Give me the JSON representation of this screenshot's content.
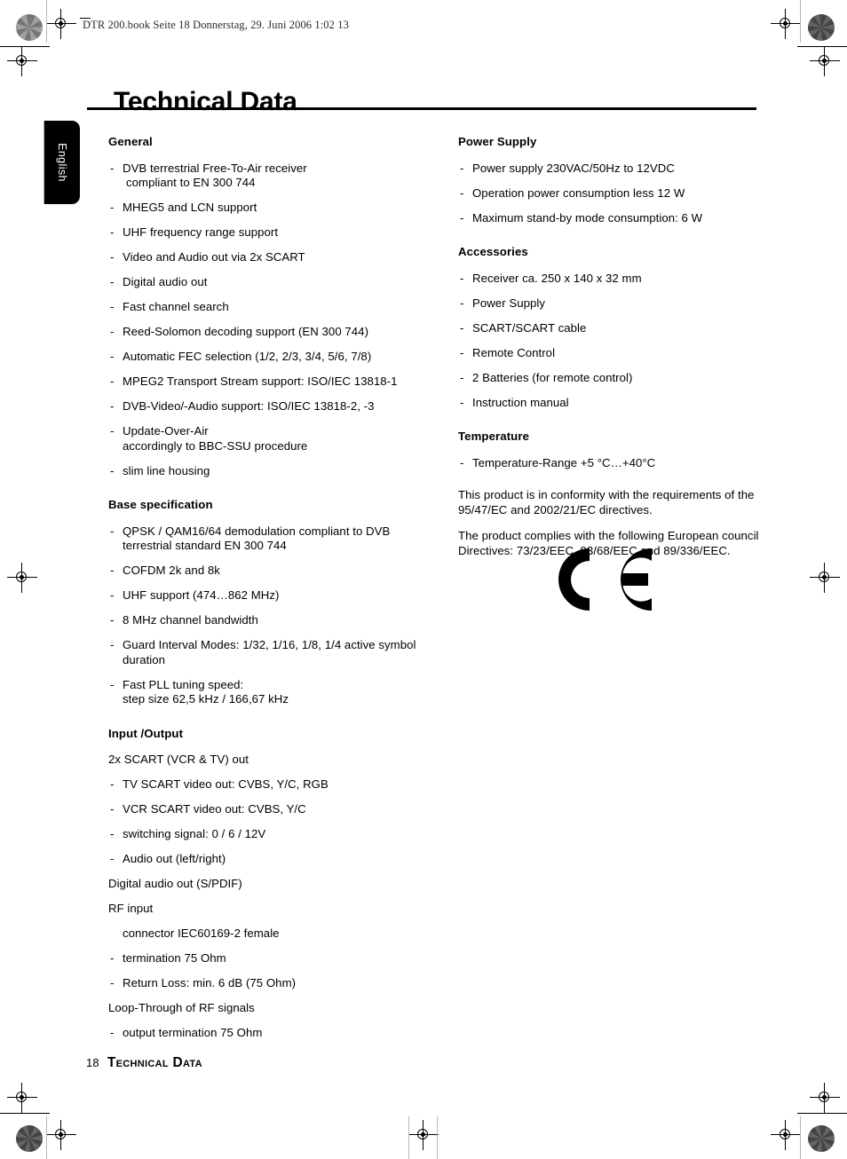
{
  "slug": {
    "text": "DTR 200.book  Seite 18  Donnerstag, 29. Juni 2006  1:02 13"
  },
  "header": {
    "title": "Technical Data"
  },
  "language_tab": {
    "label": "English"
  },
  "left_column": {
    "sections": [
      {
        "heading": "General",
        "items": [
          {
            "dash": "-",
            "text": "DVB terrestrial Free-To-Air receiver",
            "cont": "compliant to EN 300 744"
          },
          {
            "dash": "-",
            "text": "MHEG5 and LCN support"
          },
          {
            "dash": "-",
            "text": "UHF frequency range support"
          },
          {
            "dash": "-",
            "text": "Video and Audio out via 2x SCART"
          },
          {
            "dash": "-",
            "text": "Digital audio out"
          },
          {
            "dash": "-",
            "text": "Fast channel search"
          },
          {
            "dash": "-",
            "text": "Reed-Solomon decoding support (EN 300 744)"
          },
          {
            "dash": "-",
            "text": "Automatic FEC selection (1/2, 2/3, 3/4, 5/6, 7/8)"
          },
          {
            "dash": "-",
            "text": "MPEG2 Transport Stream support: ISO/IEC 13818-1"
          },
          {
            "dash": "-",
            "text": "DVB-Video/-Audio support: ISO/IEC 13818-2, -3"
          },
          {
            "dash": "-",
            "text": "Update-Over-Air",
            "cont": "accordingly to BBC-SSU procedure",
            "cont_flush": true
          },
          {
            "dash": "-",
            "text": "slim line housing"
          }
        ]
      },
      {
        "heading": "Base specification",
        "items": [
          {
            "dash": "-",
            "text": "QPSK / QAM16/64 demodulation compliant to DVB",
            "cont": "terrestrial standard EN 300 744",
            "cont_flush": true
          },
          {
            "dash": "-",
            "text": "COFDM 2k and 8k"
          },
          {
            "dash": "-",
            "text": "UHF support (474…862 MHz)"
          },
          {
            "dash": "-",
            "text": "8 MHz channel bandwidth"
          },
          {
            "dash": "-",
            "text": "Guard Interval Modes: 1/32, 1/16, 1/8, 1/4 active symbol",
            "cont": "duration",
            "cont_flush": true
          },
          {
            "dash": "-",
            "text": "Fast PLL tuning speed:",
            "cont": "step size 62,5 kHz / 166,67 kHz",
            "cont_flush": true
          }
        ]
      },
      {
        "heading": "Input /Output",
        "items": [
          {
            "dash": "",
            "text": "2x SCART (VCR & TV) out"
          },
          {
            "dash": "-",
            "text": "TV SCART video out: CVBS, Y/C, RGB"
          },
          {
            "dash": "-",
            "text": "VCR SCART video out: CVBS, Y/C"
          },
          {
            "dash": "-",
            "text": "switching signal: 0 / 6 / 12V"
          },
          {
            "dash": "-",
            "text": "Audio out (left/right)"
          },
          {
            "dash": "",
            "text": "Digital audio out (S/PDIF)"
          },
          {
            "dash": "",
            "text": "RF input"
          },
          {
            "dash": "",
            "text": "connector IEC60169-2 female",
            "indent": true
          },
          {
            "dash": "-",
            "text": "termination 75 Ohm"
          },
          {
            "dash": "-",
            "text": "Return Loss: min. 6 dB (75 Ohm)"
          },
          {
            "dash": "",
            "text": "Loop-Through of RF signals"
          },
          {
            "dash": "-",
            "text": "output termination 75 Ohm"
          }
        ]
      }
    ]
  },
  "right_column": {
    "sections": [
      {
        "heading": "Power Supply",
        "items": [
          {
            "dash": "-",
            "text": "Power supply 230VAC/50Hz to 12VDC"
          },
          {
            "dash": "-",
            "text": "Operation power consumption less 12 W"
          },
          {
            "dash": "-",
            "text": "Maximum stand-by mode consumption: 6 W"
          }
        ]
      },
      {
        "heading": "Accessories",
        "items": [
          {
            "dash": "-",
            "text": "Receiver ca. 250 x 140 x 32 mm"
          },
          {
            "dash": "-",
            "text": "Power Supply"
          },
          {
            "dash": "-",
            "text": "SCART/SCART cable"
          },
          {
            "dash": "-",
            "text": "Remote Control"
          },
          {
            "dash": "-",
            "text": "2 Batteries (for remote control)"
          },
          {
            "dash": "-",
            "text": "Instruction manual"
          }
        ]
      },
      {
        "heading": "Temperature",
        "items": [
          {
            "dash": "-",
            "text": "Temperature-Range +5 °C…+40°C"
          }
        ]
      }
    ],
    "paragraphs": [
      "This product is in conformity with the requirements of the 95/47/EC and 2002/21/EC directives.",
      "The product complies with the following European council Directives: 73/23/EEC, 93/68/EEC and 89/336/EEC."
    ],
    "ce_mark_label": "CE"
  },
  "footer": {
    "page_number": "18",
    "title": "Technical Data"
  }
}
